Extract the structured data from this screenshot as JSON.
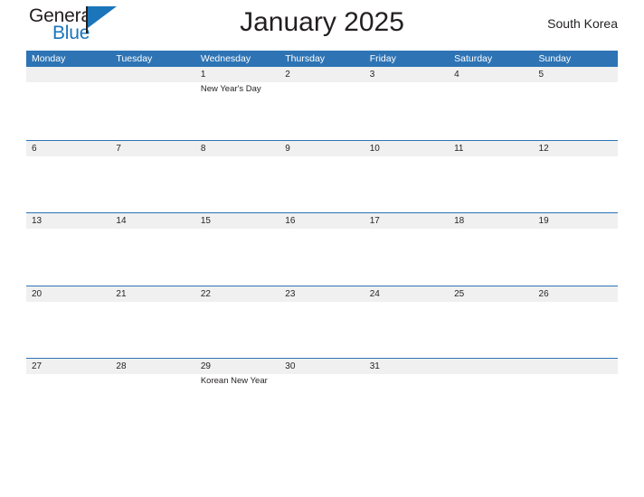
{
  "brand": {
    "name_part1": "General",
    "name_part2": "Blue",
    "color_dark": "#231f20",
    "color_blue": "#1b75bb",
    "flag_icon": "flag-triangle-icon"
  },
  "header": {
    "title": "January 2025",
    "region": "South Korea"
  },
  "theme": {
    "header_blue": "#2e74b5",
    "daynum_band_gray": "#f0f0f0",
    "text_color": "#231f20",
    "page_background": "#ffffff"
  },
  "calendar": {
    "month": "January",
    "year": "2025",
    "country": "South Korea",
    "weekdays": [
      "Monday",
      "Tuesday",
      "Wednesday",
      "Thursday",
      "Friday",
      "Saturday",
      "Sunday"
    ],
    "weeks": [
      {
        "days": [
          {
            "num": "",
            "event": ""
          },
          {
            "num": "",
            "event": ""
          },
          {
            "num": "1",
            "event": "New Year's Day"
          },
          {
            "num": "2",
            "event": ""
          },
          {
            "num": "3",
            "event": ""
          },
          {
            "num": "4",
            "event": ""
          },
          {
            "num": "5",
            "event": ""
          }
        ]
      },
      {
        "days": [
          {
            "num": "6",
            "event": ""
          },
          {
            "num": "7",
            "event": ""
          },
          {
            "num": "8",
            "event": ""
          },
          {
            "num": "9",
            "event": ""
          },
          {
            "num": "10",
            "event": ""
          },
          {
            "num": "11",
            "event": ""
          },
          {
            "num": "12",
            "event": ""
          }
        ]
      },
      {
        "days": [
          {
            "num": "13",
            "event": ""
          },
          {
            "num": "14",
            "event": ""
          },
          {
            "num": "15",
            "event": ""
          },
          {
            "num": "16",
            "event": ""
          },
          {
            "num": "17",
            "event": ""
          },
          {
            "num": "18",
            "event": ""
          },
          {
            "num": "19",
            "event": ""
          }
        ]
      },
      {
        "days": [
          {
            "num": "20",
            "event": ""
          },
          {
            "num": "21",
            "event": ""
          },
          {
            "num": "22",
            "event": ""
          },
          {
            "num": "23",
            "event": ""
          },
          {
            "num": "24",
            "event": ""
          },
          {
            "num": "25",
            "event": ""
          },
          {
            "num": "26",
            "event": ""
          }
        ]
      },
      {
        "days": [
          {
            "num": "27",
            "event": ""
          },
          {
            "num": "28",
            "event": ""
          },
          {
            "num": "29",
            "event": "Korean New Year"
          },
          {
            "num": "30",
            "event": ""
          },
          {
            "num": "31",
            "event": ""
          },
          {
            "num": "",
            "event": ""
          },
          {
            "num": "",
            "event": ""
          }
        ]
      }
    ]
  }
}
